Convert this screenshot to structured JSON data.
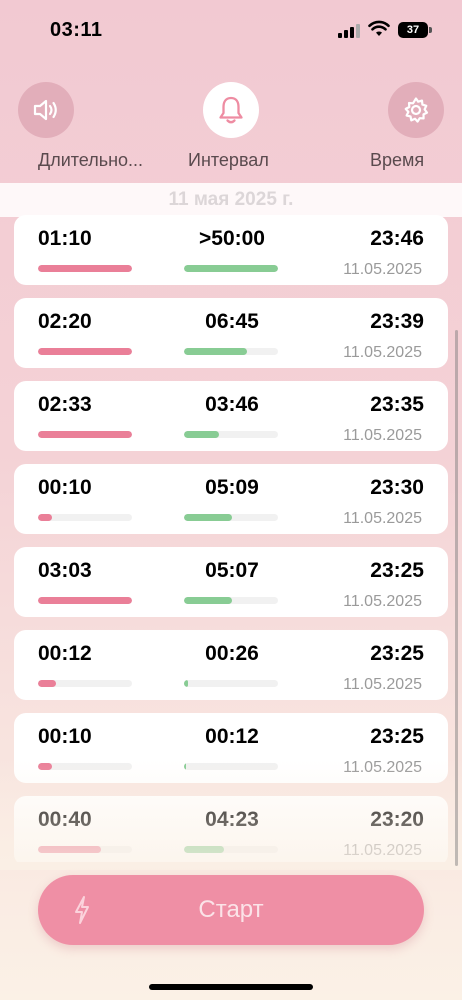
{
  "status_bar": {
    "time": "03:11",
    "battery": "37"
  },
  "toolbar": {
    "duration_label": "Длительно...",
    "interval_label": "Интервал",
    "time_label": "Время"
  },
  "date_header": "11 мая 2025 г.",
  "records": [
    {
      "duration": "01:10",
      "interval": ">50:00",
      "time": "23:46",
      "date": "11.05.2025",
      "duration_fill": 1.0,
      "interval_fill": 1.0
    },
    {
      "duration": "02:20",
      "interval": "06:45",
      "time": "23:39",
      "date": "11.05.2025",
      "duration_fill": 1.0,
      "interval_fill": 0.67
    },
    {
      "duration": "02:33",
      "interval": "03:46",
      "time": "23:35",
      "date": "11.05.2025",
      "duration_fill": 1.0,
      "interval_fill": 0.37
    },
    {
      "duration": "00:10",
      "interval": "05:09",
      "time": "23:30",
      "date": "11.05.2025",
      "duration_fill": 0.15,
      "interval_fill": 0.51
    },
    {
      "duration": "03:03",
      "interval": "05:07",
      "time": "23:25",
      "date": "11.05.2025",
      "duration_fill": 1.0,
      "interval_fill": 0.51
    },
    {
      "duration": "00:12",
      "interval": "00:26",
      "time": "23:25",
      "date": "11.05.2025",
      "duration_fill": 0.19,
      "interval_fill": 0.04
    },
    {
      "duration": "00:10",
      "interval": "00:12",
      "time": "23:25",
      "date": "11.05.2025",
      "duration_fill": 0.15,
      "interval_fill": 0.02
    },
    {
      "duration": "00:40",
      "interval": "04:23",
      "time": "23:20",
      "date": "11.05.2025",
      "duration_fill": 0.67,
      "interval_fill": 0.43
    }
  ],
  "start_button": {
    "label": "Старт"
  },
  "colors": {
    "duration_bar": "#ea7f98",
    "interval_bar": "#88cc94",
    "start_button": "#ef8fa5"
  }
}
